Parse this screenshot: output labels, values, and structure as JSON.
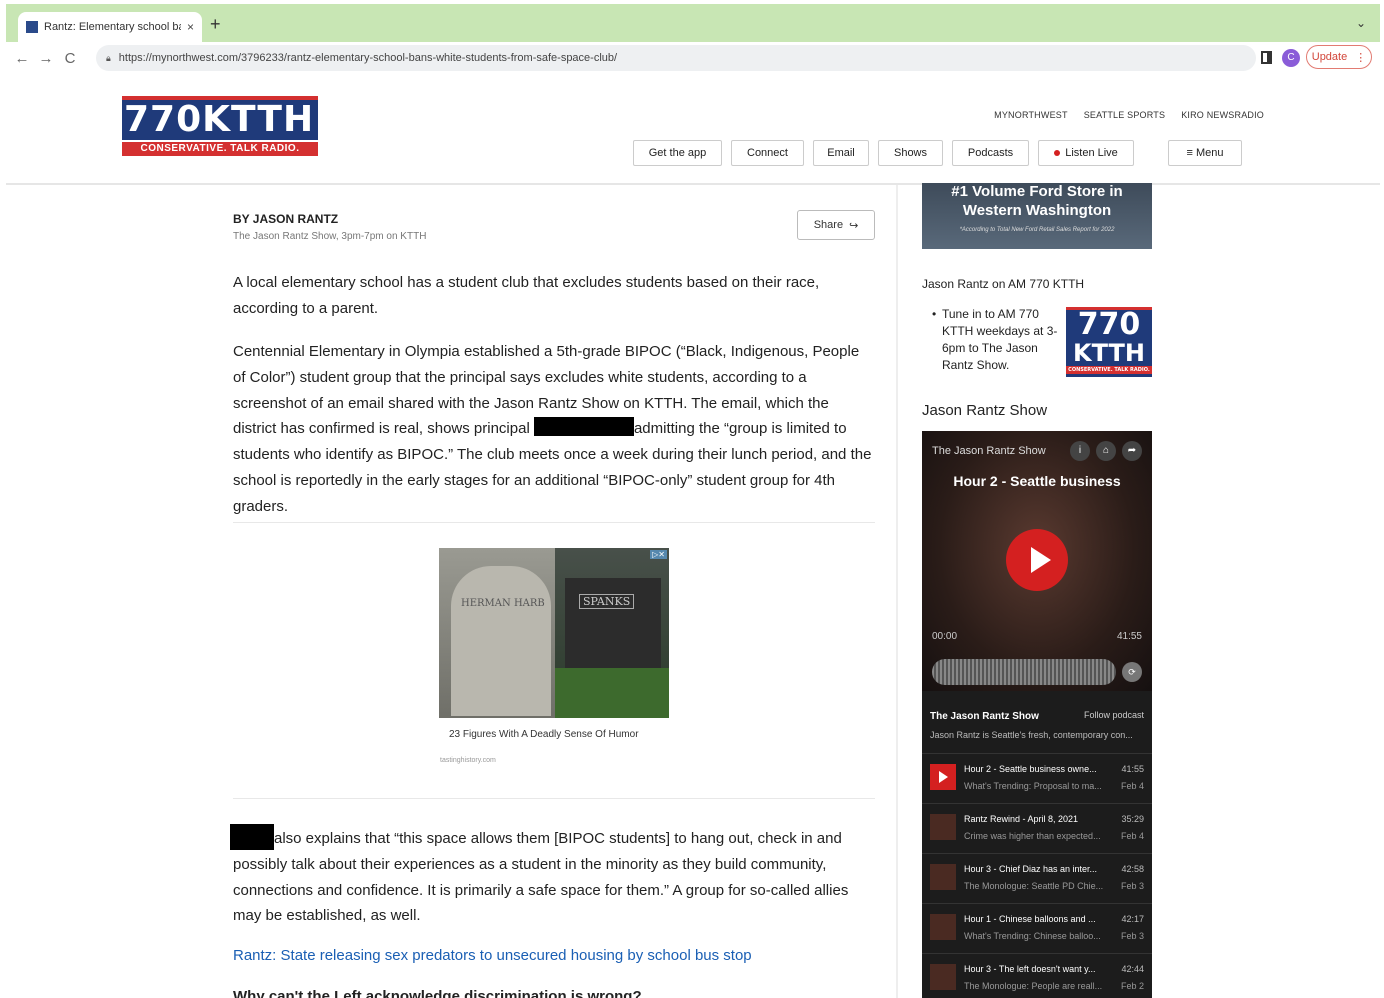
{
  "browser": {
    "tab_title": "Rantz: Elementary school bans",
    "tab_close": "×",
    "new_tab": "+",
    "tabs_menu": "⌄",
    "url": "https://mynorthwest.com/3796233/rantz-elementary-school-bans-white-students-from-safe-space-club/",
    "back": "←",
    "forward": "→",
    "reload": "C",
    "profile_initial": "C",
    "update_label": "Update",
    "update_menu": "⋮"
  },
  "header": {
    "logo_text": "770KTTH",
    "logo_tagline": "CONSERVATIVE. TALK RADIO.",
    "top_links": [
      "MYNORTHWEST",
      "SEATTLE SPORTS",
      "KIRO NEWSRADIO"
    ],
    "nav_buttons": [
      "Get the app",
      "Connect",
      "Email",
      "Shows",
      "Podcasts",
      "Listen Live",
      "≡ Menu"
    ]
  },
  "article": {
    "byline": "BY JASON RANTZ",
    "subbyline": "The Jason Rantz Show, 3pm-7pm on KTTH",
    "share_label": "Share",
    "p1": "A local elementary school has a student club that excludes students based on their race, according to a parent.",
    "p2_a": "Centennial Elementary in Olympia established a 5th-grade BIPOC (“Black, Indigenous, People of Color”) student group that the principal says excludes white students, according to a screenshot of an email shared with the Jason Rantz Show on KTTH. The email, which the district has confirmed is real, shows principal ",
    "p2_b": "admitting the “group is limited to students who identify as BIPOC.” The club meets once a week during their lunch period, and the school is reportedly in the early stages for an additional “BIPOC-only” student group for 4th graders.",
    "ad_caption": "23 Figures With A Deadly Sense Of Humor",
    "ad_source": "tastinghistory.com",
    "ad_stone1": "HERMAN HARB",
    "ad_stone2": "SPANKS",
    "ad_choice": "▷✕",
    "p3": "also explains that “this space allows them [BIPOC students] to hang out, check in and possibly talk about their experiences as a student in the minority as they build community, connections and confidence. It is primarily a safe space for them.” A group for so-called allies may be established, as well.",
    "related_link": "Rantz: State releasing sex predators to unsecured housing by school bus stop",
    "cutoff_heading": "Why can't the Left acknowledge discrimination is wrong?"
  },
  "sidebar": {
    "promo_line1": "#1 Volume Ford Store in",
    "promo_line2": "Western Washington",
    "promo_fine": "*According to Total New Ford Retail Sales Report for 2022",
    "heading1": "Jason Rantz on AM 770 KTTH",
    "bullet": "Tune in to AM 770 KTTH weekdays at 3-6pm to The Jason Rantz Show.",
    "mini_logo_1": "770",
    "mini_logo_2": "KTTH",
    "mini_logo_3": "CONSERVATIVE. TALK RADIO.",
    "heading2": "Jason Rantz Show"
  },
  "player": {
    "brand": "The Jason Rantz Show",
    "icons": [
      "i",
      "⌂",
      "➦"
    ],
    "now_title": "Hour 2 - Seattle business",
    "time_elapsed": "00:00",
    "time_total": "41:55",
    "speed": "⟳",
    "show_name": "The Jason Rantz Show",
    "follow_label": "Follow podcast",
    "show_desc": "Jason Rantz is Seattle's fresh, contemporary con...",
    "episodes": [
      {
        "title": "Hour 2 - Seattle business owne...",
        "sub": "What's Trending: Proposal to ma...",
        "dur": "41:55",
        "date": "Feb 4"
      },
      {
        "title": "Rantz Rewind - April 8, 2021",
        "sub": "Crime was higher than expected...",
        "dur": "35:29",
        "date": "Feb 4"
      },
      {
        "title": "Hour 3 - Chief Diaz has an inter...",
        "sub": "The Monologue: Seattle PD Chie...",
        "dur": "42:58",
        "date": "Feb 3"
      },
      {
        "title": "Hour 1 - Chinese balloons and ...",
        "sub": "What's Trending: Chinese balloo...",
        "dur": "42:17",
        "date": "Feb 3"
      },
      {
        "title": "Hour 3 - The left doesn't want y...",
        "sub": "The Monologue: People are reall...",
        "dur": "42:44",
        "date": "Feb 2"
      }
    ]
  }
}
